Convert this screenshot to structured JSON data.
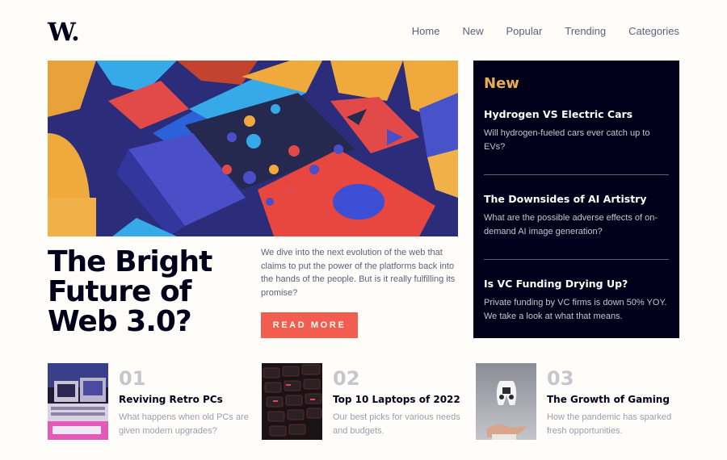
{
  "logo": {
    "text": "W."
  },
  "nav": {
    "items": [
      {
        "label": "Home"
      },
      {
        "label": "New"
      },
      {
        "label": "Popular"
      },
      {
        "label": "Trending"
      },
      {
        "label": "Categories"
      }
    ]
  },
  "hero": {
    "title": "The Bright Future of Web 3.0?",
    "description": "We dive into the next evolution of the web that claims to put the power of the platforms back into the hands of the people. But is it really fulfilling its promise?",
    "button_label": "READ MORE"
  },
  "new_panel": {
    "heading": "New",
    "items": [
      {
        "title": "Hydrogen VS Electric Cars",
        "description": "Will hydrogen-fueled cars ever catch up to EVs?"
      },
      {
        "title": "The Downsides of AI Artistry",
        "description": "What are the possible adverse effects of on-demand AI image generation?"
      },
      {
        "title": "Is VC Funding Drying Up?",
        "description": "Private funding by VC firms is down 50% YOY. We take a look at what that means."
      }
    ]
  },
  "cards": [
    {
      "number": "01",
      "title": "Reviving Retro PCs",
      "description": "What happens when old PCs are given modern upgrades?"
    },
    {
      "number": "02",
      "title": "Top 10 Laptops of 2022",
      "description": "Our best picks for various needs and budgets."
    },
    {
      "number": "03",
      "title": "The Growth of Gaming",
      "description": "How the pandemic has sparked fresh opportunities."
    }
  ],
  "colors": {
    "accent": "#f15e50",
    "panel_bg": "#00001a",
    "panel_heading": "#e9ab53",
    "background": "#fffdfa"
  }
}
